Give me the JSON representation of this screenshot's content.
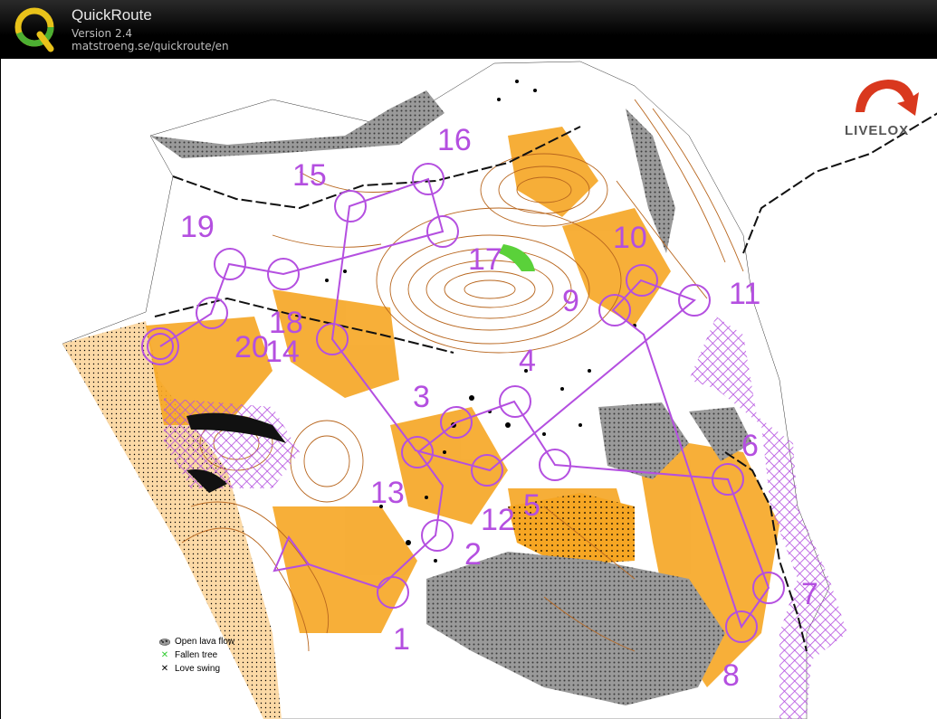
{
  "app": {
    "title": "QuickRoute",
    "version": "Version 2.4",
    "url": "matstroeng.se/quickroute/en"
  },
  "brand": {
    "livelox": "LIVELOX"
  },
  "legend": [
    {
      "symbol": "lava-dots",
      "label": "Open lava flow"
    },
    {
      "symbol": "green-x",
      "label": "Fallen tree"
    },
    {
      "symbol": "black-x",
      "label": "Love swing"
    }
  ],
  "course": {
    "color": "#b44fe0",
    "control_numbers": [
      "1",
      "2",
      "3",
      "4",
      "5",
      "6",
      "7",
      "8",
      "9",
      "10",
      "11",
      "12",
      "13",
      "14",
      "15",
      "16",
      "17",
      "18",
      "19",
      "20"
    ]
  },
  "colors": {
    "open_land": "#f6a623",
    "rough_open": "#fbd59a",
    "contour": "#b8661e",
    "lava": "#8c8c8c",
    "course": "#b44fe0",
    "fallen_tree": "#33cc33"
  }
}
